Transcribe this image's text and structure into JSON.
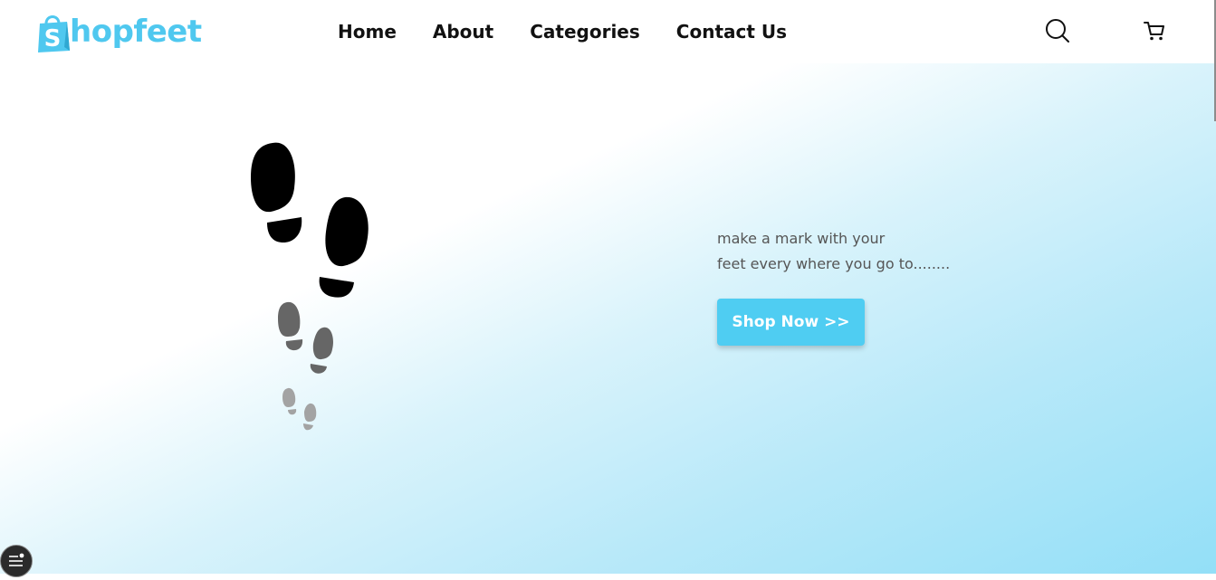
{
  "brand": {
    "logo_text": "hopfeet",
    "logo_letter": "S",
    "color": "#4fc8ef"
  },
  "nav": {
    "items": [
      "Home",
      "About",
      "Categories",
      "Contact Us"
    ]
  },
  "header_icons": {
    "search": "search-icon",
    "cart": "cart-icon"
  },
  "hero": {
    "tagline_line1": "make a mark with your",
    "tagline_line2": "feet every where you go to........",
    "cta_label": "Shop Now >>",
    "cta_color": "#4fcdf2",
    "footprint_colors": [
      "#000000",
      "#666666",
      "#a3a3a3"
    ]
  },
  "widgets": {
    "menu_fab": "menu-icon"
  }
}
